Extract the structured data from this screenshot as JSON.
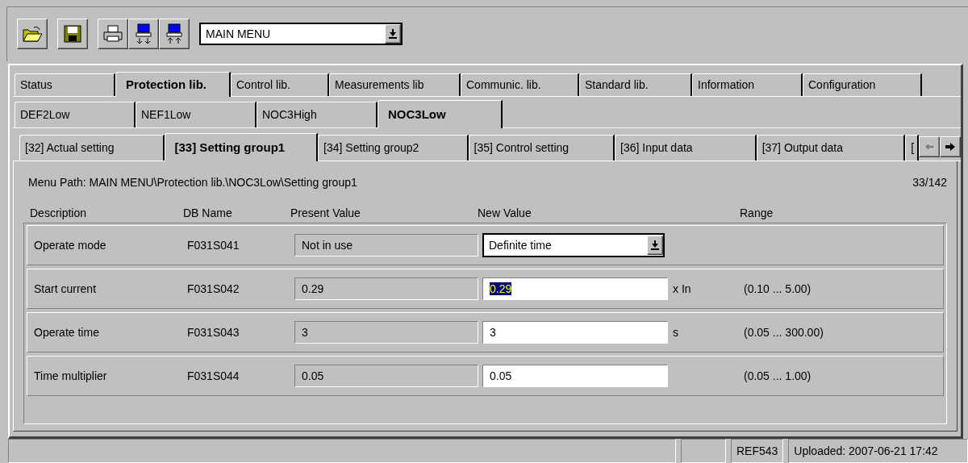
{
  "toolbar": {
    "buttons": [
      {
        "kind": "open"
      },
      {
        "kind": "save"
      },
      {
        "kind": "print"
      },
      {
        "kind": "download"
      },
      {
        "kind": "upload"
      }
    ],
    "menu_select": {
      "value": "MAIN MENU"
    }
  },
  "library_tabs": [
    {
      "label": "Status",
      "selected": false
    },
    {
      "label": "Protection lib.",
      "selected": true
    },
    {
      "label": "Control lib.",
      "selected": false
    },
    {
      "label": "Measurements lib",
      "selected": false
    },
    {
      "label": "Communic. lib.",
      "selected": false
    },
    {
      "label": "Standard lib.",
      "selected": false
    },
    {
      "label": "Information",
      "selected": false
    },
    {
      "label": "Configuration",
      "selected": false
    }
  ],
  "function_tabs": [
    {
      "label": "DEF2Low",
      "selected": false
    },
    {
      "label": "NEF1Low",
      "selected": false
    },
    {
      "label": "NOC3High",
      "selected": false
    },
    {
      "label": "NOC3Low",
      "selected": true
    }
  ],
  "page_tabs": [
    {
      "label": "[32] Actual setting",
      "selected": false
    },
    {
      "label": "[33] Setting group1",
      "selected": true
    },
    {
      "label": "[34] Setting group2",
      "selected": false
    },
    {
      "label": "[35] Control setting",
      "selected": false
    },
    {
      "label": "[36] Input data",
      "selected": false
    },
    {
      "label": "[37] Output data",
      "selected": false
    },
    {
      "label": "[",
      "selected": false
    }
  ],
  "tab_scroll": [
    {
      "kind": "left",
      "disabled": true
    },
    {
      "kind": "right",
      "disabled": false
    }
  ],
  "menu_path": "Menu Path:  MAIN MENU\\Protection lib.\\NOC3Low\\Setting group1",
  "page_counter": "33/142",
  "table": {
    "columns": [
      "Description",
      "DB Name",
      "Present Value",
      "New Value",
      "Range"
    ],
    "rows": [
      {
        "description": "Operate mode",
        "db_name": "F031S041",
        "present_value": "Not in use",
        "new_value": {
          "kind": "dropdown",
          "value": "Definite time",
          "selected": false
        }
      },
      {
        "description": "Start current",
        "db_name": "F031S042",
        "present_value": "0.29",
        "new_value": {
          "kind": "text",
          "value": "0.29",
          "selected": true
        },
        "unit": "x In",
        "range": "(0.10 ... 5.00)"
      },
      {
        "description": "Operate time",
        "db_name": "F031S043",
        "present_value": "3",
        "new_value": {
          "kind": "text",
          "value": "3",
          "selected": false
        },
        "unit": "s",
        "range": "(0.05 ... 300.00)"
      },
      {
        "description": "Time multiplier",
        "db_name": "F031S044",
        "present_value": "0.05",
        "new_value": {
          "kind": "text",
          "value": "0.05",
          "selected": false
        },
        "range": "(0.05 ... 1.00)"
      }
    ]
  },
  "status_bar": {
    "panels": [
      {
        "kind": "blank"
      },
      {
        "kind": "blank"
      },
      {
        "kind": "text",
        "text": "REF543"
      },
      {
        "kind": "text",
        "text": "Uploaded: 2007-06-21 17:42"
      }
    ]
  }
}
